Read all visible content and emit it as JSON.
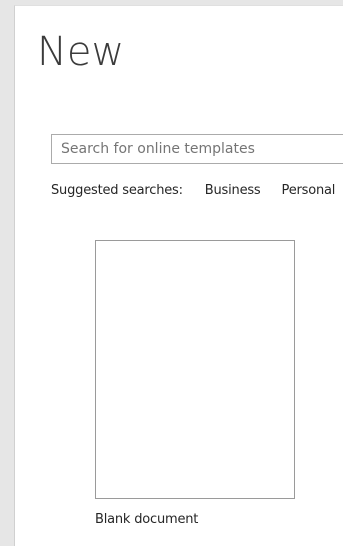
{
  "page": {
    "title": "New"
  },
  "search": {
    "placeholder": "Search for online templates"
  },
  "suggested": {
    "label": "Suggested searches:",
    "items": [
      "Business",
      "Personal"
    ]
  },
  "templates": [
    {
      "label": "Blank document"
    }
  ]
}
